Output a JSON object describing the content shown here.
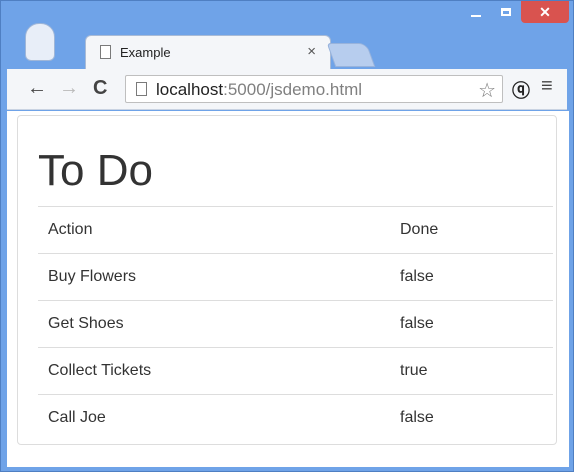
{
  "browser": {
    "tab_title": "Example",
    "tab_close": "×",
    "url_host": "localhost",
    "url_rest": ":5000/jsdemo.html",
    "window_controls": {
      "minimize": "minimize",
      "maximize": "maximize",
      "close": "✕"
    },
    "nav": {
      "back": "←",
      "forward": "→",
      "reload": "C",
      "star": "☆",
      "menu": "≡",
      "extension": "ⓠ"
    }
  },
  "page": {
    "title": "To Do",
    "table": {
      "headers": [
        "Action",
        "Done"
      ],
      "rows": [
        [
          "Buy Flowers",
          "false"
        ],
        [
          "Get Shoes",
          "false"
        ],
        [
          "Collect Tickets",
          "true"
        ],
        [
          "Call Joe",
          "false"
        ]
      ]
    }
  },
  "colors": {
    "window_frame": "#6fa3e8",
    "close_button": "#d9534f",
    "tab_background": "#f4f6f9",
    "text": "#333333"
  }
}
